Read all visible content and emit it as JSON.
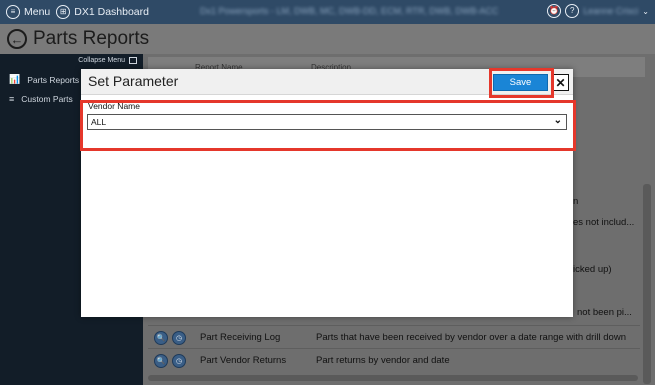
{
  "topbar": {
    "menu_label": "Menu",
    "app_label": "DX1 Dashboard",
    "context_text": "Dx1 Powersports - LM, DWB, MC, DWB-DD, ECM, RTR, DWB, DWB-ACC",
    "user_name": "Leanne Crisci"
  },
  "page": {
    "title": "Parts Reports"
  },
  "sidebar": {
    "collapse_label": "Collapse Menu",
    "items": [
      {
        "label": "Parts Reports",
        "icon": "chart-icon",
        "active": true
      },
      {
        "label": "Custom Parts",
        "icon": "list-edit-icon",
        "active": false
      }
    ]
  },
  "table": {
    "columns": [
      "Report Name",
      "Description"
    ],
    "fragments": [
      "n",
      "es not includ...",
      "icked up)",
      "not been pi..."
    ],
    "rows": [
      {
        "name": "Part Receiving Log",
        "description": "Parts that have been received by vendor over a date range with drill down"
      },
      {
        "name": "Part Vendor Returns",
        "description": "Part returns by vendor and date"
      }
    ]
  },
  "modal": {
    "title": "Set Parameter",
    "save_label": "Save",
    "close_label": "✕",
    "field_label": "Vendor Name",
    "field_value": "ALL"
  },
  "colors": {
    "topbar": "#2f4a66",
    "sidebar": "#121d28",
    "save_button": "#1a85d6",
    "highlight": "#e5372b"
  }
}
